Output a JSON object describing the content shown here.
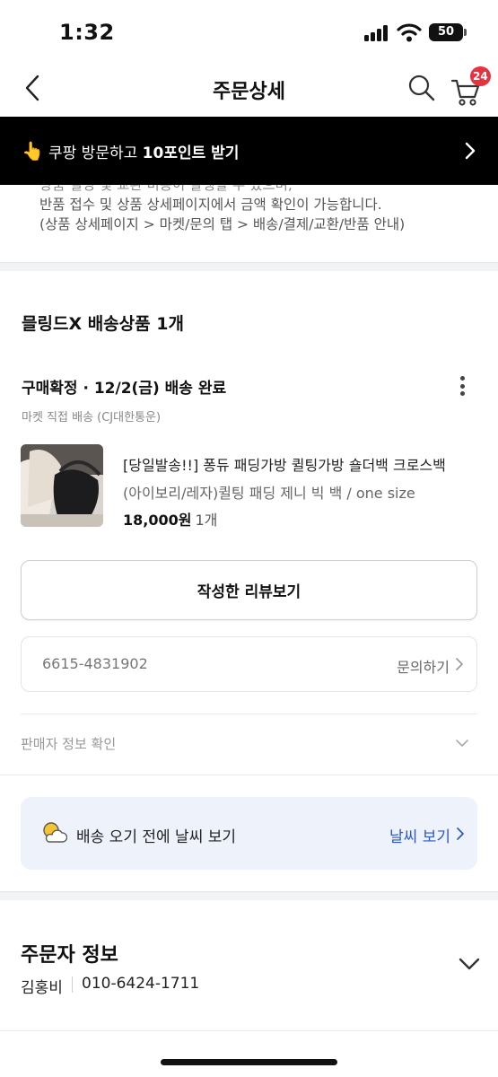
{
  "status_bar": {
    "time": "1:32",
    "battery": "50",
    "icons": [
      "signal-icon",
      "wifi-icon",
      "battery-icon"
    ]
  },
  "header": {
    "title": "주문상세",
    "back_icon": "chevron-left-icon",
    "search_icon": "search-icon",
    "cart_icon": "cart-icon",
    "cart_badge": "24",
    "badge_color": "#e5333f"
  },
  "promo_banner": {
    "icon": "pointing-hand-icon",
    "text_prefix": "쿠팡 방문하고 ",
    "text_bold": "10포인트 받기",
    "background": "#000000"
  },
  "notice": {
    "partial_line": "상품 설명 및 교환 비용이 발생할 수 있으며,",
    "line1": "반품 접수 및 상품 상세페이지에서 금액 확인이 가능합니다.",
    "line2": "(상품 상세페이지 > 마켓/문의 탭 > 배송/결제/교환/반품 안내)"
  },
  "order": {
    "section_title": "믈링드X 배송상품 1개",
    "status": "구매확정 · 12/2(금) 배송 완료",
    "delivery_method": "마켓 직접 배송 (CJ대한통운)",
    "product": {
      "title": "[당일발송!!] 퐁듀 패딩가방 퀼팅가방 숄더백 크로스백",
      "option": "(아이보리/레자)퀼팅 패딩 제니 빅 백 / one size",
      "price": "18,000원",
      "quantity": "1개"
    },
    "review_button": "작성한 리뷰보기",
    "order_number": "6615-4831902",
    "inquiry_label": "문의하기",
    "seller_info_label": "판매자 정보 확인"
  },
  "weather": {
    "text": "배송 오기 전에 날씨 보기",
    "link": "날씨 보기",
    "link_color": "#2d58c9",
    "card_background": "#eef2fb"
  },
  "orderer": {
    "title": "주문자 정보",
    "name": "김홍비",
    "phone": "010-6424-1711"
  }
}
